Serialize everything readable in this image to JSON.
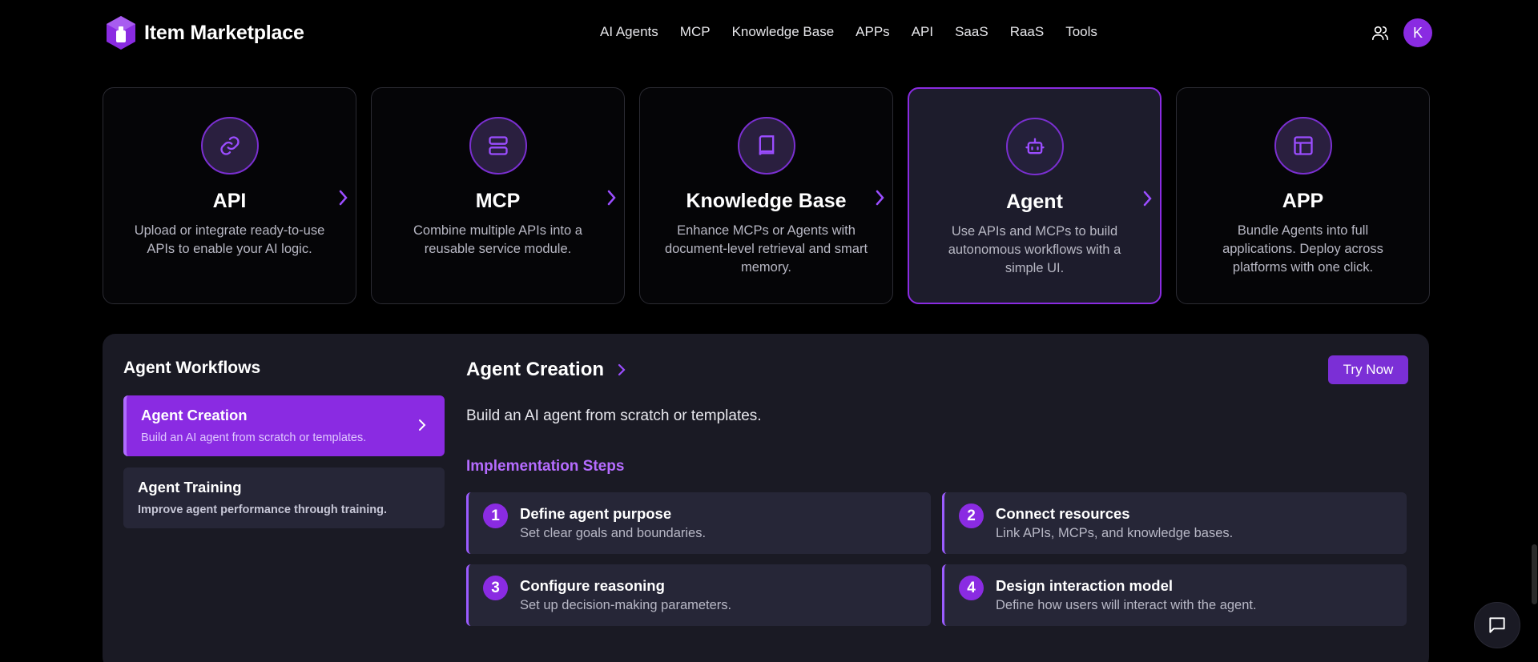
{
  "header": {
    "brand": "Item Marketplace",
    "nav": [
      "AI Agents",
      "MCP",
      "Knowledge Base",
      "APPs",
      "API",
      "SaaS",
      "RaaS",
      "Tools"
    ],
    "avatar_initial": "K",
    "accent_color": "#8a2be2"
  },
  "cards": [
    {
      "title": "API",
      "icon": "link-icon",
      "desc": "Upload or integrate ready-to-use APIs to enable your AI logic."
    },
    {
      "title": "MCP",
      "icon": "server-icon",
      "desc": "Combine multiple APIs into a reusable service module."
    },
    {
      "title": "Knowledge Base",
      "icon": "book-icon",
      "desc": "Enhance MCPs or Agents with document-level retrieval and smart memory."
    },
    {
      "title": "Agent",
      "icon": "bot-icon",
      "desc": "Use APIs and MCPs to build autonomous workflows with a simple UI."
    },
    {
      "title": "APP",
      "icon": "layout-icon",
      "desc": "Bundle Agents into full applications. Deploy across platforms with one click."
    }
  ],
  "workflows": {
    "title": "Agent Workflows",
    "items": [
      {
        "title": "Agent Creation",
        "desc": "Build an AI agent from scratch or templates."
      },
      {
        "title": "Agent Training",
        "desc": "Improve agent performance through training."
      }
    ]
  },
  "detail": {
    "title": "Agent Creation",
    "try_label": "Try Now",
    "desc": "Build an AI agent from scratch or templates.",
    "steps_title": "Implementation Steps",
    "steps": [
      {
        "num": "1",
        "title": "Define agent purpose",
        "desc": "Set clear goals and boundaries."
      },
      {
        "num": "2",
        "title": "Connect resources",
        "desc": "Link APIs, MCPs, and knowledge bases."
      },
      {
        "num": "3",
        "title": "Configure reasoning",
        "desc": "Set up decision-making parameters."
      },
      {
        "num": "4",
        "title": "Design interaction model",
        "desc": "Define how users will interact with the agent."
      }
    ]
  }
}
